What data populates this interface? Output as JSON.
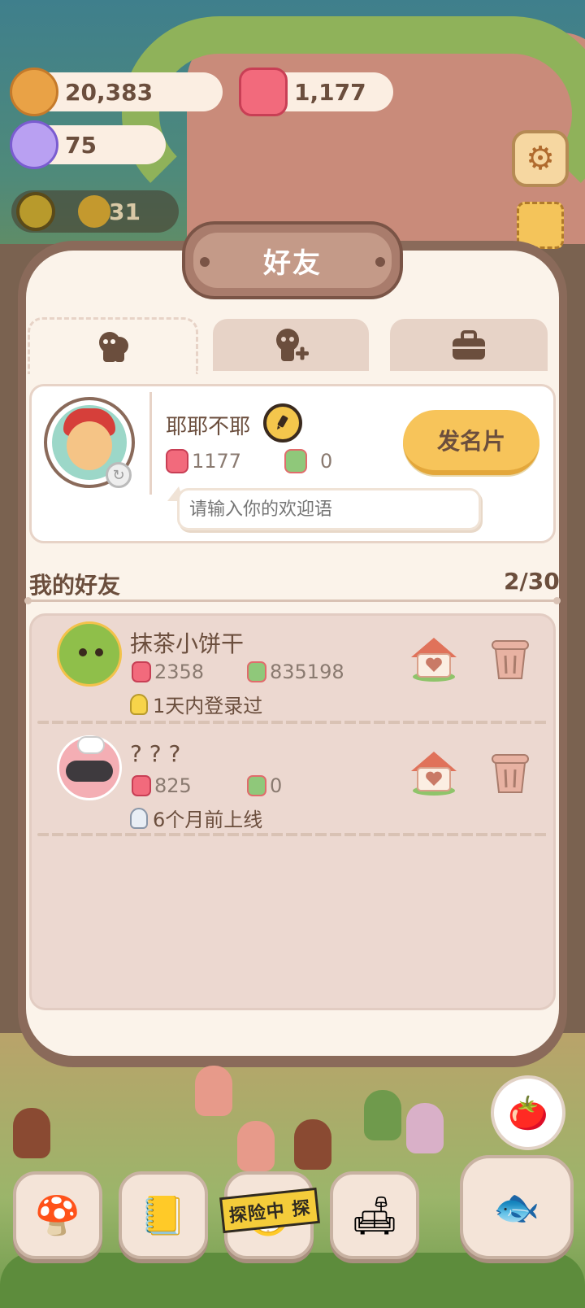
{
  "currencies": {
    "cookies": "20,383",
    "jellies": "1,177",
    "crystals": "75"
  },
  "level": {
    "value": "31"
  },
  "dialog": {
    "title": "好友"
  },
  "tabs": [
    {
      "id": "friends",
      "icon": "friends-icon",
      "active": true
    },
    {
      "id": "add-friend",
      "icon": "add-friend-icon",
      "active": false
    },
    {
      "id": "bag",
      "icon": "briefcase-icon",
      "active": false
    }
  ],
  "profile": {
    "name": "耶耶不耶",
    "jelly_count": "1177",
    "card_count": "0",
    "send_card_label": "发名片",
    "greeting_placeholder": "请输入你的欢迎语"
  },
  "friends_section": {
    "title": "我的好友",
    "count": "2/30",
    "friends": [
      {
        "name": "抹茶小饼干",
        "jellies": "2358",
        "cards": "835198",
        "login_status": "1天内登录过",
        "online_recent": true
      },
      {
        "name": "? ? ?",
        "jellies": "825",
        "cards": "0",
        "login_status": "6个月前上线",
        "online_recent": false
      }
    ]
  },
  "bottom_nav": {
    "adventure_label": "探险中 探"
  },
  "colors": {
    "panel_bg": "#fbf3ea",
    "frame": "#8a6a5a",
    "accent_button": "#f7c45a",
    "text_brown": "#6b4e3d"
  }
}
